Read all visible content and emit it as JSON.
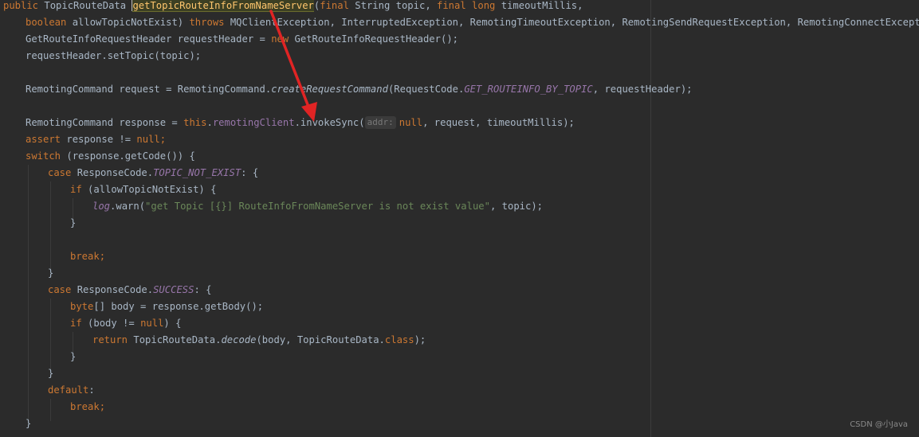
{
  "editor": {
    "language": "Java",
    "colors": {
      "background": "#2b2b2b",
      "keyword": "#cc7832",
      "method_decl": "#ffc66d",
      "field": "#9876aa",
      "string": "#6a8759",
      "plain": "#a9b7c6",
      "annotation_arrow": "#e02424"
    },
    "lines": {
      "l1": {
        "kw_public": "public",
        "ret_type": " TopicRouteData ",
        "method_name": "getTopicRouteInfoFromNameServer",
        "p1": "(",
        "kw_final1": "final",
        "p2": " String topic, ",
        "kw_final2": "final",
        "sp": " ",
        "kw_long": "long",
        "p3": " timeoutMillis,"
      },
      "l2": {
        "kw_boolean": "boolean",
        "p1": " allowTopicNotExist) ",
        "kw_throws": "throws",
        "p2": " MQClientException, InterruptedException, RemotingTimeoutException, RemotingSendRequestException, RemotingConnectException {"
      },
      "l3": {
        "p1": "GetRouteInfoRequestHeader requestHeader = ",
        "kw_new": "new",
        "p2": " GetRouteInfoRequestHeader();"
      },
      "l4": {
        "p1": "requestHeader.setTopic(topic);"
      },
      "l5": {
        "p1": "RemotingCommand request = RemotingCommand.",
        "m_create": "createRequestCommand",
        "p2": "(RequestCode.",
        "c_code": "GET_ROUTEINFO_BY_TOPIC",
        "p3": ", requestHeader);"
      },
      "l6": {
        "p1": "RemotingCommand response = ",
        "kw_this": "this",
        "dot": ".",
        "f_client": "remotingClient",
        "p2": ".invokeSync(",
        "hint_addr": "addr:",
        "kw_null": "null",
        "p3": ", request, timeoutMillis);"
      },
      "l7": {
        "kw_assert": "assert",
        "p1": " response != ",
        "kw_null": "null",
        "p2": ";"
      },
      "l8": {
        "kw_switch": "switch",
        "p1": " (response.getCode()) {"
      },
      "l9": {
        "kw_case": "case",
        "p1": " ResponseCode.",
        "c_not_exist": "TOPIC_NOT_EXIST",
        "p2": ": {"
      },
      "l10": {
        "kw_if": "if",
        "p1": " (allowTopicNotExist) {"
      },
      "l11": {
        "f_log": "log",
        "p1": ".warn(",
        "s_msg": "\"get Topic [{}] RouteInfoFromNameServer is not exist value\"",
        "p2": ", topic);"
      },
      "l12": {
        "p1": "}"
      },
      "l13": {
        "kw_break": "break",
        "p1": ";"
      },
      "l14": {
        "p1": "}"
      },
      "l15": {
        "kw_case": "case",
        "p1": " ResponseCode.",
        "c_success": "SUCCESS",
        "p2": ": {"
      },
      "l16": {
        "kw_byte": "byte",
        "p1": "[] body = response.getBody();"
      },
      "l17": {
        "kw_if": "if",
        "p1": " (body != ",
        "kw_null": "null",
        "p2": ") {"
      },
      "l18": {
        "kw_return": "return",
        "p1": " TopicRouteData.",
        "m_decode": "decode",
        "p2": "(body, TopicRouteData.",
        "kw_class": "class",
        "p3": ");"
      },
      "l19": {
        "p1": "}"
      },
      "l20": {
        "p1": "}"
      },
      "l21": {
        "kw_default": "default",
        "p1": ":"
      },
      "l22": {
        "kw_break": "break",
        "p1": ";"
      },
      "l23": {
        "p1": "}"
      }
    }
  },
  "watermark": {
    "corner_text": "CSDN @小Java"
  }
}
